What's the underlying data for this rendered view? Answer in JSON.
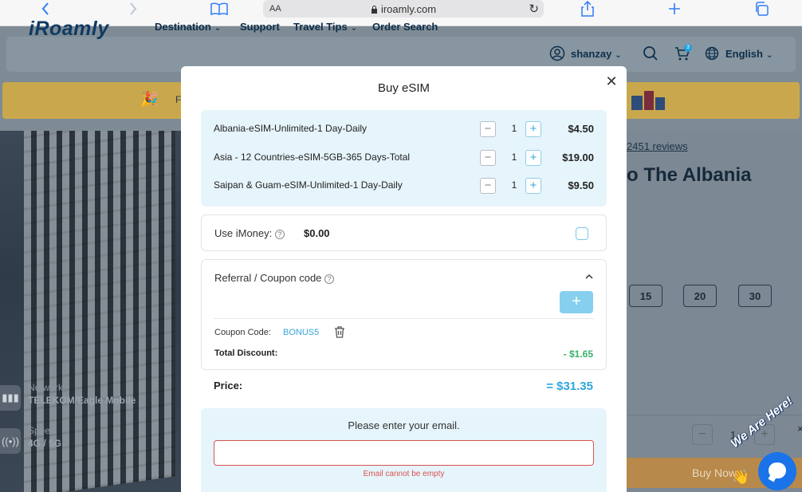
{
  "browser": {
    "aa_label": "AA",
    "url": "iroamly.com"
  },
  "header": {
    "logo": "iRoamly",
    "nav": [
      {
        "label": "Destination",
        "has_dropdown": true
      },
      {
        "label": "Support",
        "has_dropdown": false
      },
      {
        "label": "Travel Tips",
        "has_dropdown": true
      },
      {
        "label": "Order Search",
        "has_dropdown": false
      }
    ],
    "username": "shanzay",
    "cart_count": "3",
    "language": "English"
  },
  "background": {
    "banner_text_start": "F",
    "network_label": "Network",
    "network_value": "TELEKOM/Eagle Mobile",
    "speed_label": "Speed",
    "speed_value": "4G / 5G",
    "reviews": "2451 reviews",
    "title_fragment": "o The Albania",
    "day_options": [
      "15",
      "20",
      "30"
    ],
    "qty_value": "1",
    "buy_now": "Buy Now",
    "chat_banner": "We Are Here!"
  },
  "modal": {
    "title": "Buy eSIM",
    "items": [
      {
        "name": "Albania-eSIM-Unlimited-1 Day-Daily",
        "qty": "1",
        "price": "$4.50"
      },
      {
        "name": "Asia - 12 Countries-eSIM-5GB-365 Days-Total",
        "qty": "1",
        "price": "$19.00"
      },
      {
        "name": "Saipan & Guam-eSIM-Unlimited-1 Day-Daily",
        "qty": "1",
        "price": "$9.50"
      }
    ],
    "imoney_label": "Use iMoney:",
    "imoney_amount": "$0.00",
    "coupon_header": "Referral / Coupon code",
    "coupon_code_label": "Coupon Code:",
    "coupon_code_value": "BONUS5",
    "total_discount_label": "Total Discount:",
    "total_discount_value": "- $1.65",
    "price_label": "Price:",
    "price_value": "= $31.35",
    "email_prompt": "Please enter your email.",
    "email_value": "",
    "email_error": "Email cannot be empty"
  },
  "colors": {
    "accent": "#2fa6dc",
    "discount": "#37b26a",
    "error": "#d9534f"
  }
}
